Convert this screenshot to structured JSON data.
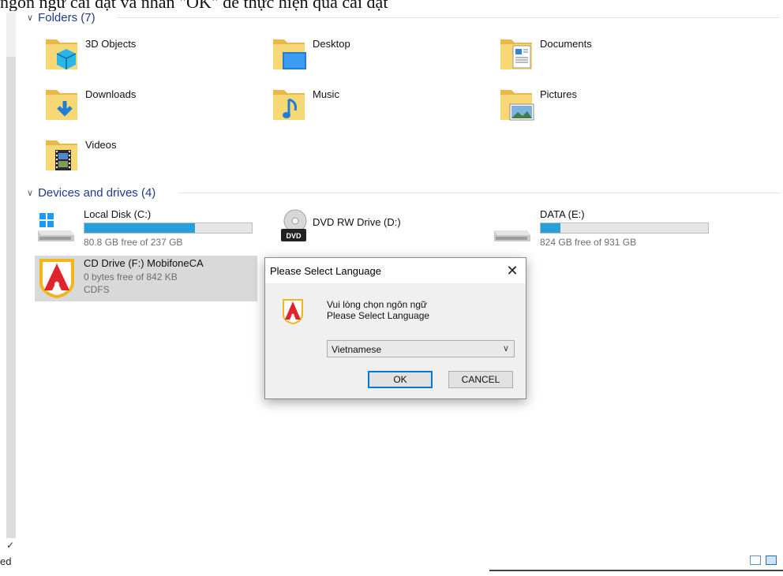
{
  "doc_line": "ngôn ngữ cài đặt và nhấn \"OK\" để thực hiện quá cài đặt",
  "sections": {
    "folders": "Folders (7)",
    "drives": "Devices and drives (4)"
  },
  "folders": [
    {
      "label": "3D Objects",
      "icon": "3d-objects-icon"
    },
    {
      "label": "Desktop",
      "icon": "desktop-icon"
    },
    {
      "label": "Documents",
      "icon": "documents-icon"
    },
    {
      "label": "Downloads",
      "icon": "downloads-icon"
    },
    {
      "label": "Music",
      "icon": "music-icon"
    },
    {
      "label": "Pictures",
      "icon": "pictures-icon"
    },
    {
      "label": "Videos",
      "icon": "videos-icon"
    }
  ],
  "drives": [
    {
      "name": "Local Disk (C:)",
      "free": "80.8 GB free of 237 GB",
      "used_fraction": 0.66,
      "icon": "windows-drive-icon"
    },
    {
      "name": "DVD RW Drive (D:)",
      "icon": "dvd-drive-icon"
    },
    {
      "name": "DATA (E:)",
      "free": "824 GB free of 931 GB",
      "used_fraction": 0.12,
      "icon": "hard-drive-icon"
    },
    {
      "name": "CD Drive (F:) MobifoneCA",
      "free": "0 bytes free of 842 KB",
      "fs": "CDFS",
      "icon": "mobifoneca-logo-icon"
    }
  ],
  "dialog": {
    "title": "Please Select Language",
    "close": "✕",
    "message_line1": "Vui lòng chọn ngôn ngữ",
    "message_line2": "Please Select Language",
    "selected_language": "Vietnamese",
    "ok_label": "OK",
    "cancel_label": "CANCEL"
  },
  "status": {
    "left_text": "ed",
    "tick": "✓"
  },
  "colors": {
    "progress_fill": "#26a0da",
    "folder_yellow": "#f8d775",
    "logo_red": "#e0242b",
    "logo_gold": "#f2b61b"
  }
}
